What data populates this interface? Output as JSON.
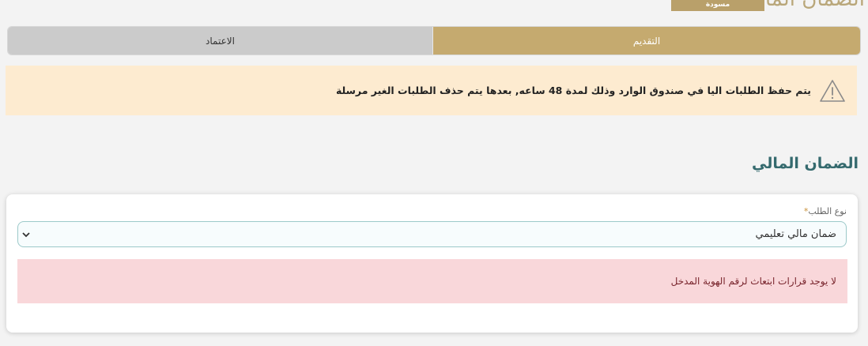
{
  "header": {
    "title": "الضمان المالي",
    "status_badge": "مسودة"
  },
  "stepper": {
    "steps": [
      {
        "label": "التقديم",
        "state": "active"
      },
      {
        "label": "الاعتماد",
        "state": "inactive"
      }
    ]
  },
  "warning": {
    "icon": "warning-triangle-icon",
    "text": "يتم حفظ الطلبات اليا في صندوق الوارد وذلك لمدة 48 ساعه, بعدها يتم حذف الطلبات الغير مرسلة"
  },
  "section": {
    "heading": "الضمان المالي"
  },
  "form": {
    "request_type_label": "نوع الطلب",
    "required_marker": "*",
    "request_type_value": "ضمان مالي تعليمي",
    "error_message": "لا يوجد قرارات ابتعاث لرقم الهوية المدخل"
  },
  "colors": {
    "accent_gold": "#c5aa6f",
    "heading_teal": "#356a6e",
    "warning_bg": "#fdebd0",
    "error_bg": "#f9d7da"
  }
}
